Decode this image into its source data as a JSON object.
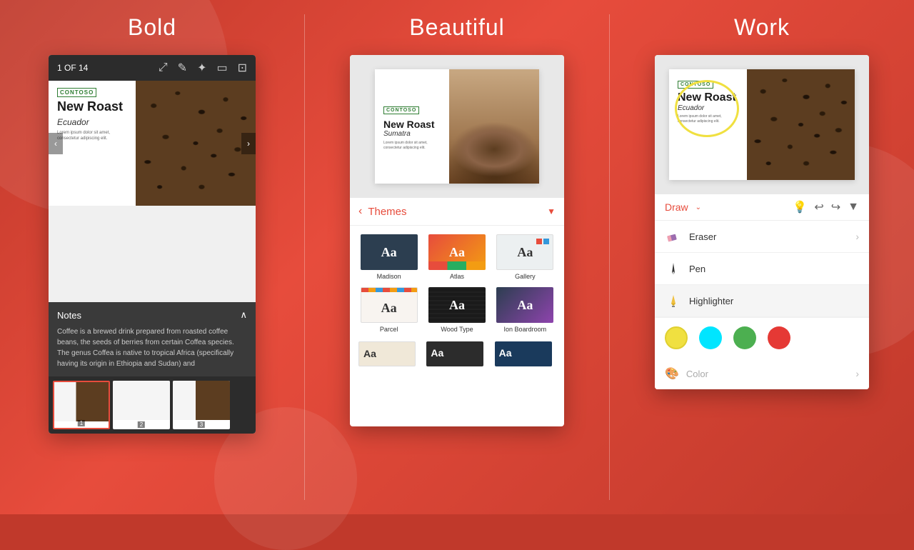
{
  "background": {
    "color": "#c0392b"
  },
  "columns": [
    {
      "id": "bold",
      "title": "Bold"
    },
    {
      "id": "beautiful",
      "title": "Beautiful"
    },
    {
      "id": "work",
      "title": "Work"
    }
  ],
  "leftPanel": {
    "toolbar": {
      "counter": "1 OF 14",
      "icons": [
        "⤢",
        "✎",
        "✦",
        "⬜",
        "⬛"
      ]
    },
    "slide": {
      "logo": "CONTOSO",
      "title": "New Roast",
      "subtitle": "Ecuador",
      "bodyText": "Lorem ipsum dolor sit amet, consectetur adipiscing elit."
    },
    "notes": {
      "header": "Notes",
      "text": "Coffee is a brewed drink prepared from roasted coffee beans, the seeds of berries from certain Coffea species. The genus Coffea is native to tropical Africa (specifically having its origin in Ethiopia and Sudan) and"
    },
    "thumbnails": [
      {
        "number": "1",
        "active": true
      },
      {
        "number": "2",
        "active": false
      },
      {
        "number": "3",
        "active": false
      }
    ]
  },
  "middlePanel": {
    "slide": {
      "logo": "CONTOSO",
      "title": "New Roast",
      "subtitle": "Sumatra",
      "bodyText": "Lorem ipsum dolor sit amet, consectetur adipiscing elit."
    },
    "themesBar": {
      "backLabel": "‹",
      "label": "Themes",
      "arrow": "▼"
    },
    "themes": [
      {
        "id": "madison",
        "name": "Madison",
        "style": "dark"
      },
      {
        "id": "atlas",
        "name": "Atlas",
        "style": "colorful"
      },
      {
        "id": "gallery",
        "name": "Gallery",
        "style": "light"
      },
      {
        "id": "parcel",
        "name": "Parcel",
        "style": "warm"
      },
      {
        "id": "woodtype",
        "name": "Wood Type",
        "style": "dark"
      },
      {
        "id": "ion",
        "name": "Ion Boardroom",
        "style": "purple"
      }
    ]
  },
  "rightPanel": {
    "slide": {
      "logo": "CONTOSO",
      "title": "New Roast",
      "subtitle": "Ecuador",
      "bodyText": "Lorem ipsum dolor sit amet, consectetur adipiscing elit."
    },
    "drawToolbar": {
      "label": "Draw",
      "icons": [
        "💡",
        "↩",
        "↪",
        "▼"
      ]
    },
    "tools": [
      {
        "id": "eraser",
        "name": "Eraser",
        "icon": "✏",
        "hasChevron": true
      },
      {
        "id": "pen",
        "name": "Pen",
        "icon": "▲",
        "hasChevron": false
      },
      {
        "id": "highlighter",
        "name": "Highlighter",
        "icon": "▼",
        "active": true,
        "hasChevron": false
      }
    ],
    "colors": [
      {
        "id": "yellow",
        "color": "#f0e040"
      },
      {
        "id": "cyan",
        "color": "#00e5ff"
      },
      {
        "id": "green",
        "color": "#4caf50"
      },
      {
        "id": "red",
        "color": "#e53935"
      }
    ],
    "colorOption": {
      "label": "Color",
      "hasChevron": true
    }
  }
}
